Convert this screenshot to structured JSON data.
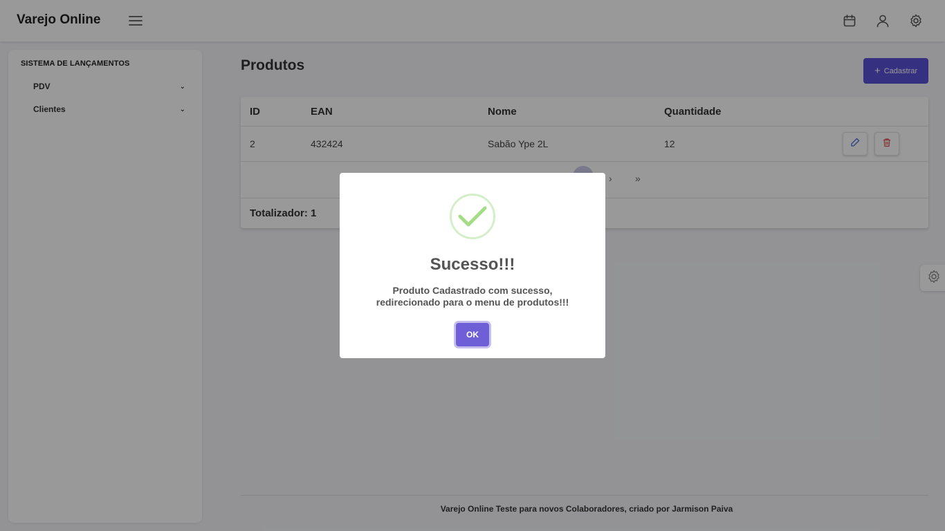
{
  "header": {
    "brand": "Varejo Online",
    "icons": [
      "menu-icon",
      "calendar-icon",
      "user-icon",
      "gear-icon"
    ]
  },
  "sidebar": {
    "title": "SISTEMA DE LANÇAMENTOS",
    "items": [
      {
        "label": "PDV",
        "icon": "chevron-down-icon"
      },
      {
        "label": "Clientes",
        "icon": "chevron-down-icon"
      }
    ]
  },
  "page": {
    "title": "Produtos",
    "add_button_label": "Cadastrar",
    "add_button_icon": "plus-icon",
    "accent_color": "#5a50d8"
  },
  "table": {
    "columns": [
      "ID",
      "EAN",
      "Nome",
      "Quantidade"
    ],
    "rows": [
      {
        "id": "2",
        "ean": "432424",
        "nome": "Sabão Ype 2L",
        "quantidade": "12"
      }
    ],
    "row_actions": [
      "edit-icon",
      "trash-icon"
    ],
    "pagination": {
      "next": "›",
      "last": "»"
    },
    "total_label": "Totalizador: 1"
  },
  "footer": {
    "text": "Varejo Online Teste para novos Colaboradores, criado por Jarmison Paiva"
  },
  "modal": {
    "icon": "success-check-icon",
    "title": "Sucesso!!!",
    "message": "Produto Cadastrado com sucesso, redirecionado para o menu de produtos!!!",
    "ok_label": "OK",
    "success_color": "#a5dc86"
  }
}
